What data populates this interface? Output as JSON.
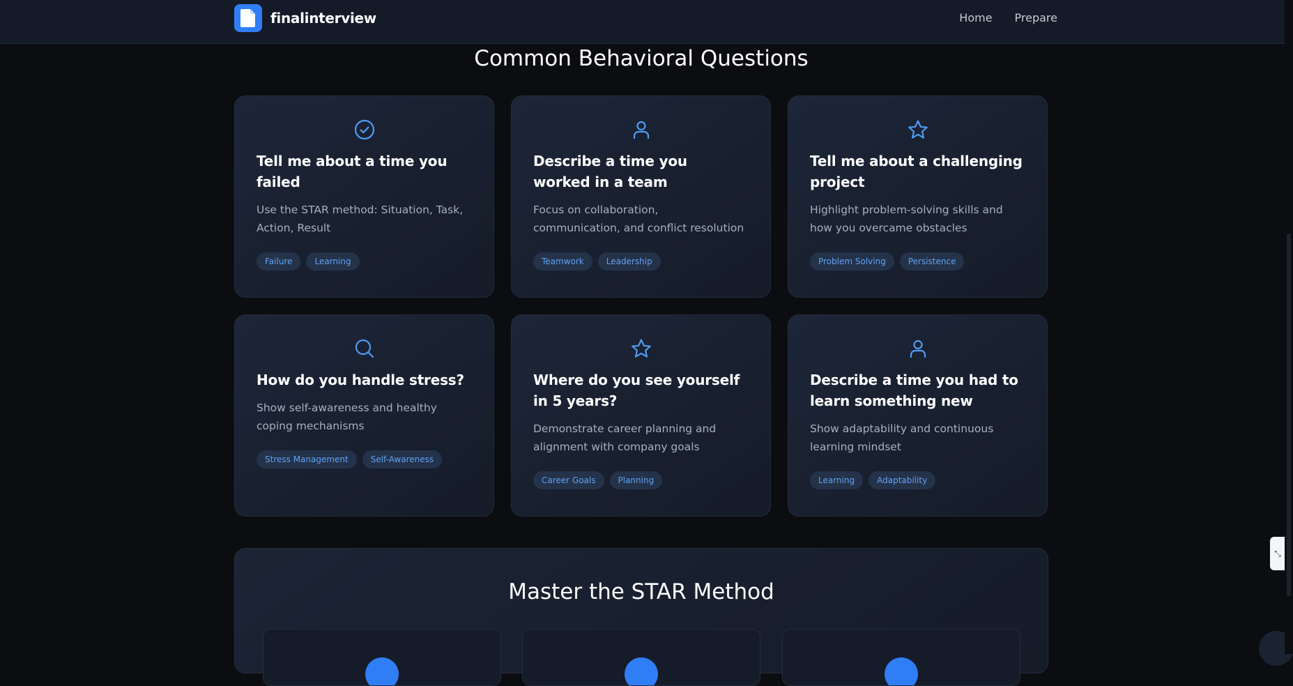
{
  "brand": {
    "name": "finalinterview",
    "logo_icon": "document-icon"
  },
  "nav": {
    "links": [
      "Home",
      "Prepare"
    ]
  },
  "questions_section": {
    "title": "Common Behavioral Questions",
    "cards": [
      {
        "icon": "check-circle-icon",
        "title": "Tell me about a time you failed",
        "description": "Use the STAR method: Situation, Task, Action, Result",
        "tags": [
          "Failure",
          "Learning"
        ]
      },
      {
        "icon": "user-icon",
        "title": "Describe a time you worked in a team",
        "description": "Focus on collaboration, communication, and conflict resolution",
        "tags": [
          "Teamwork",
          "Leadership"
        ]
      },
      {
        "icon": "star-icon",
        "title": "Tell me about a challenging project",
        "description": "Highlight problem-solving skills and how you overcame obstacles",
        "tags": [
          "Problem Solving",
          "Persistence"
        ]
      },
      {
        "icon": "search-icon",
        "title": "How do you handle stress?",
        "description": "Show self-awareness and healthy coping mechanisms",
        "tags": [
          "Stress Management",
          "Self-Awareness"
        ]
      },
      {
        "icon": "star-icon",
        "title": "Where do you see yourself in 5 years?",
        "description": "Demonstrate career planning and alignment with company goals",
        "tags": [
          "Career Goals",
          "Planning"
        ]
      },
      {
        "icon": "user-icon",
        "title": "Describe a time you had to learn something new",
        "description": "Show adaptability and continuous learning mindset",
        "tags": [
          "Learning",
          "Adaptability"
        ]
      }
    ]
  },
  "star_section": {
    "title": "Master the STAR Method"
  },
  "colors": {
    "accent": "#2f7ef5",
    "tag_text": "#61a3f5",
    "tag_bg": "#24324a",
    "icon": "#4f9bf3"
  }
}
